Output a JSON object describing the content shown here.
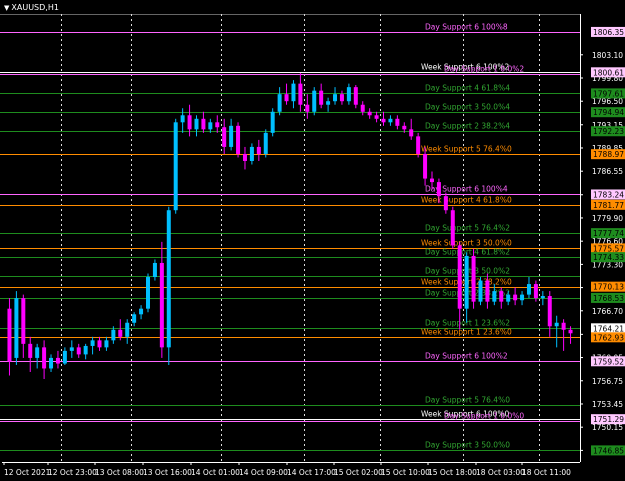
{
  "window": {
    "symbol": "XAUUSD,H1",
    "dropdown_glyph": "▼"
  },
  "colors": {
    "background": "#000000",
    "bull": "#00bfff",
    "bear": "#ff00ff",
    "grid": "#ffffff",
    "day_line": "#c080c0",
    "week_line": "#ff8c00",
    "green_line": "#1e8c1e",
    "green_text": "#32a832",
    "pink_line": "#ff66ff"
  },
  "chart_data": {
    "type": "candlestick",
    "ylim": [
      1745.2,
      1808.9
    ],
    "y_ticks": [
      "1803.10",
      "1799.80",
      "1796.50",
      "1793.15",
      "1789.85",
      "1786.55",
      "1783.20",
      "1779.90",
      "1776.60",
      "1773.30",
      "1770.00",
      "1766.70",
      "1763.35",
      "1760.05",
      "1756.75",
      "1753.45",
      "1750.15",
      "1746.85"
    ],
    "x_ticks": [
      "12 Oct 2021",
      "12 Oct 23:00",
      "13 Oct 08:00",
      "13 Oct 16:00",
      "14 Oct 01:00",
      "14 Oct 09:00",
      "14 Oct 17:00",
      "15 Oct 02:00",
      "15 Oct 10:00",
      "15 Oct 18:00",
      "18 Oct 03:00",
      "18 Oct 11:00"
    ],
    "candles": [
      {
        "o": 1767.0,
        "h": 1768.5,
        "l": 1757.5,
        "c": 1759.5
      },
      {
        "o": 1760.0,
        "h": 1769.5,
        "l": 1759.0,
        "c": 1768.5
      },
      {
        "o": 1768.5,
        "h": 1769.0,
        "l": 1760.0,
        "c": 1762.0
      },
      {
        "o": 1762.0,
        "h": 1763.0,
        "l": 1758.0,
        "c": 1760.0
      },
      {
        "o": 1760.0,
        "h": 1762.0,
        "l": 1758.5,
        "c": 1761.5
      },
      {
        "o": 1761.5,
        "h": 1762.5,
        "l": 1757.0,
        "c": 1758.5
      },
      {
        "o": 1758.5,
        "h": 1760.5,
        "l": 1758.0,
        "c": 1760.0
      },
      {
        "o": 1760.0,
        "h": 1761.0,
        "l": 1758.5,
        "c": 1759.2
      },
      {
        "o": 1759.2,
        "h": 1761.5,
        "l": 1759.0,
        "c": 1761.0
      },
      {
        "o": 1761.0,
        "h": 1762.5,
        "l": 1760.0,
        "c": 1761.5
      },
      {
        "o": 1761.5,
        "h": 1762.0,
        "l": 1760.0,
        "c": 1760.5
      },
      {
        "o": 1760.5,
        "h": 1762.0,
        "l": 1759.8,
        "c": 1761.7
      },
      {
        "o": 1761.7,
        "h": 1763.0,
        "l": 1760.5,
        "c": 1762.5
      },
      {
        "o": 1762.5,
        "h": 1763.0,
        "l": 1761.0,
        "c": 1761.5
      },
      {
        "o": 1761.5,
        "h": 1763.0,
        "l": 1761.0,
        "c": 1762.5
      },
      {
        "o": 1762.5,
        "h": 1764.5,
        "l": 1762.0,
        "c": 1764.0
      },
      {
        "o": 1764.0,
        "h": 1765.5,
        "l": 1762.5,
        "c": 1763.0
      },
      {
        "o": 1763.0,
        "h": 1765.5,
        "l": 1762.0,
        "c": 1765.0
      },
      {
        "o": 1765.0,
        "h": 1766.5,
        "l": 1764.5,
        "c": 1766.2
      },
      {
        "o": 1766.2,
        "h": 1767.5,
        "l": 1765.5,
        "c": 1767.0
      },
      {
        "o": 1767.0,
        "h": 1772.0,
        "l": 1766.5,
        "c": 1771.5
      },
      {
        "o": 1771.5,
        "h": 1774.0,
        "l": 1771.0,
        "c": 1773.5
      },
      {
        "o": 1773.5,
        "h": 1776.5,
        "l": 1760.0,
        "c": 1761.5
      },
      {
        "o": 1761.5,
        "h": 1781.5,
        "l": 1759.0,
        "c": 1781.0
      },
      {
        "o": 1781.0,
        "h": 1794.0,
        "l": 1780.5,
        "c": 1793.5
      },
      {
        "o": 1793.5,
        "h": 1795.5,
        "l": 1792.0,
        "c": 1794.5
      },
      {
        "o": 1794.5,
        "h": 1796.0,
        "l": 1791.5,
        "c": 1792.5
      },
      {
        "o": 1792.5,
        "h": 1794.5,
        "l": 1791.5,
        "c": 1794.0
      },
      {
        "o": 1794.0,
        "h": 1795.0,
        "l": 1792.0,
        "c": 1792.5
      },
      {
        "o": 1792.5,
        "h": 1794.0,
        "l": 1792.0,
        "c": 1793.5
      },
      {
        "o": 1793.5,
        "h": 1794.5,
        "l": 1792.0,
        "c": 1792.8
      },
      {
        "o": 1792.8,
        "h": 1794.0,
        "l": 1789.0,
        "c": 1790.0
      },
      {
        "o": 1790.0,
        "h": 1794.0,
        "l": 1789.5,
        "c": 1793.0
      },
      {
        "o": 1793.0,
        "h": 1793.5,
        "l": 1788.5,
        "c": 1789.0
      },
      {
        "o": 1789.0,
        "h": 1790.0,
        "l": 1786.8,
        "c": 1788.0
      },
      {
        "o": 1788.0,
        "h": 1790.5,
        "l": 1787.5,
        "c": 1790.0
      },
      {
        "o": 1790.0,
        "h": 1791.0,
        "l": 1788.0,
        "c": 1789.0
      },
      {
        "o": 1789.0,
        "h": 1792.5,
        "l": 1788.5,
        "c": 1792.0
      },
      {
        "o": 1792.0,
        "h": 1795.5,
        "l": 1791.5,
        "c": 1795.0
      },
      {
        "o": 1795.0,
        "h": 1798.5,
        "l": 1794.5,
        "c": 1797.5
      },
      {
        "o": 1797.5,
        "h": 1799.0,
        "l": 1796.0,
        "c": 1796.5
      },
      {
        "o": 1796.5,
        "h": 1799.5,
        "l": 1795.5,
        "c": 1799.0
      },
      {
        "o": 1799.0,
        "h": 1800.5,
        "l": 1795.0,
        "c": 1796.0
      },
      {
        "o": 1796.0,
        "h": 1797.5,
        "l": 1794.0,
        "c": 1795.0
      },
      {
        "o": 1795.0,
        "h": 1798.5,
        "l": 1794.5,
        "c": 1798.0
      },
      {
        "o": 1798.0,
        "h": 1799.0,
        "l": 1795.5,
        "c": 1796.0
      },
      {
        "o": 1796.0,
        "h": 1797.0,
        "l": 1795.0,
        "c": 1796.5
      },
      {
        "o": 1796.5,
        "h": 1798.5,
        "l": 1796.0,
        "c": 1797.5
      },
      {
        "o": 1797.5,
        "h": 1798.0,
        "l": 1796.0,
        "c": 1796.5
      },
      {
        "o": 1796.5,
        "h": 1799.0,
        "l": 1796.0,
        "c": 1798.5
      },
      {
        "o": 1798.5,
        "h": 1798.8,
        "l": 1795.5,
        "c": 1796.0
      },
      {
        "o": 1796.0,
        "h": 1796.5,
        "l": 1794.5,
        "c": 1795.0
      },
      {
        "o": 1795.0,
        "h": 1795.5,
        "l": 1794.0,
        "c": 1794.5
      },
      {
        "o": 1794.5,
        "h": 1795.0,
        "l": 1793.5,
        "c": 1794.0
      },
      {
        "o": 1794.0,
        "h": 1795.0,
        "l": 1793.0,
        "c": 1793.5
      },
      {
        "o": 1793.5,
        "h": 1794.5,
        "l": 1793.0,
        "c": 1794.0
      },
      {
        "o": 1794.0,
        "h": 1794.5,
        "l": 1792.5,
        "c": 1793.0
      },
      {
        "o": 1793.0,
        "h": 1793.5,
        "l": 1792.0,
        "c": 1792.5
      },
      {
        "o": 1792.5,
        "h": 1794.0,
        "l": 1791.0,
        "c": 1791.5
      },
      {
        "o": 1791.5,
        "h": 1792.0,
        "l": 1788.5,
        "c": 1789.0
      },
      {
        "o": 1789.0,
        "h": 1790.0,
        "l": 1784.5,
        "c": 1785.5
      },
      {
        "o": 1785.5,
        "h": 1786.5,
        "l": 1784.0,
        "c": 1785.0
      },
      {
        "o": 1785.0,
        "h": 1785.5,
        "l": 1782.0,
        "c": 1783.0
      },
      {
        "o": 1783.0,
        "h": 1783.5,
        "l": 1780.5,
        "c": 1781.0
      },
      {
        "o": 1781.0,
        "h": 1781.5,
        "l": 1775.5,
        "c": 1776.0
      },
      {
        "o": 1776.0,
        "h": 1776.5,
        "l": 1764.0,
        "c": 1767.0
      },
      {
        "o": 1767.0,
        "h": 1775.0,
        "l": 1765.0,
        "c": 1774.5
      },
      {
        "o": 1774.5,
        "h": 1775.5,
        "l": 1767.0,
        "c": 1768.0
      },
      {
        "o": 1768.0,
        "h": 1771.5,
        "l": 1767.5,
        "c": 1771.0
      },
      {
        "o": 1771.0,
        "h": 1772.0,
        "l": 1767.0,
        "c": 1768.0
      },
      {
        "o": 1768.0,
        "h": 1770.5,
        "l": 1767.5,
        "c": 1769.5
      },
      {
        "o": 1769.5,
        "h": 1770.0,
        "l": 1767.0,
        "c": 1768.0
      },
      {
        "o": 1768.0,
        "h": 1769.5,
        "l": 1767.5,
        "c": 1769.0
      },
      {
        "o": 1769.0,
        "h": 1770.0,
        "l": 1767.5,
        "c": 1768.2
      },
      {
        "o": 1768.2,
        "h": 1769.5,
        "l": 1767.5,
        "c": 1769.0
      },
      {
        "o": 1769.0,
        "h": 1771.5,
        "l": 1768.5,
        "c": 1770.5
      },
      {
        "o": 1770.5,
        "h": 1771.0,
        "l": 1768.0,
        "c": 1768.5
      },
      {
        "o": 1768.5,
        "h": 1769.5,
        "l": 1767.5,
        "c": 1768.8
      },
      {
        "o": 1768.8,
        "h": 1769.5,
        "l": 1763.0,
        "c": 1764.5
      },
      {
        "o": 1764.5,
        "h": 1766.0,
        "l": 1761.5,
        "c": 1765.0
      },
      {
        "o": 1765.0,
        "h": 1765.5,
        "l": 1761.0,
        "c": 1764.0
      },
      {
        "o": 1764.0,
        "h": 1764.5,
        "l": 1762.0,
        "c": 1763.5
      }
    ]
  },
  "price_axis": {
    "boxes": [
      {
        "text": "1806.35",
        "fill": "#ffc8ff",
        "v": 1806.35
      },
      {
        "text": "1800.61",
        "fill": "#ffc8ff",
        "v": 1800.61
      },
      {
        "text": "1797.61",
        "fill": "#1e8c1e",
        "v": 1797.61
      },
      {
        "text": "1794.94",
        "fill": "#1e8c1e",
        "v": 1794.94
      },
      {
        "text": "1792.23",
        "fill": "#1e8c1e",
        "v": 1792.23
      },
      {
        "text": "1788.97",
        "fill": "#ff8c00",
        "v": 1788.97
      },
      {
        "text": "1783.24",
        "fill": "#ffc8ff",
        "v": 1783.24
      },
      {
        "text": "1781.77",
        "fill": "#ff8c00",
        "v": 1781.77
      },
      {
        "text": "1777.74",
        "fill": "#1e8c1e",
        "v": 1777.74
      },
      {
        "text": "1775.57",
        "fill": "#ff8c00",
        "v": 1775.57
      },
      {
        "text": "1774.33",
        "fill": "#1e8c1e",
        "v": 1774.33
      },
      {
        "text": "1770.13",
        "fill": "#ff8c00",
        "v": 1770.13
      },
      {
        "text": "1768.53",
        "fill": "#1e8c1e",
        "v": 1768.53
      },
      {
        "text": "1764.21",
        "fill": "#ffffff",
        "v": 1764.21
      },
      {
        "text": "1762.93",
        "fill": "#ff8c00",
        "v": 1762.93
      },
      {
        "text": "1759.52",
        "fill": "#ffc8ff",
        "v": 1759.52
      },
      {
        "text": "1751.29",
        "fill": "#ffc8ff",
        "v": 1751.29
      },
      {
        "text": "1746.85",
        "fill": "#1e8c1e",
        "v": 1746.85
      }
    ]
  },
  "levels": [
    {
      "label": "Day Support 6 100%8",
      "v": 1806.35,
      "line": "#ff66ff",
      "text": "#ff66ff",
      "lx": 425
    },
    {
      "label": "Week Support 6 100%2",
      "v": 1800.61,
      "line": "#ffffff",
      "text": "#ffffff",
      "lx": 421
    },
    {
      "label": "Day Support 1 0.0%2",
      "v": 1800.4,
      "line": "#ff66ff",
      "text": "#ff66ff",
      "lx": 444
    },
    {
      "label": "Day Support 4 61.8%4",
      "v": 1797.61,
      "line": "#1e8c1e",
      "text": "#32a832",
      "lx": 425
    },
    {
      "label": "Day Support 3 50.0%4",
      "v": 1794.94,
      "line": "#1e8c1e",
      "text": "#32a832",
      "lx": 425
    },
    {
      "label": "Day Support 2 38.2%4",
      "v": 1792.23,
      "line": "#1e8c1e",
      "text": "#32a832",
      "lx": 425
    },
    {
      "label": "Week Support 5 76.4%0",
      "v": 1788.97,
      "line": "#ff8c00",
      "text": "#ff8c00",
      "lx": 421
    },
    {
      "label": "Day Support 6 100%4",
      "v": 1783.24,
      "line": "#ff66ff",
      "text": "#ff66ff",
      "lx": 425
    },
    {
      "label": "Week Support 4 61.8%0",
      "v": 1781.77,
      "line": "#ff8c00",
      "text": "#ff8c00",
      "lx": 421
    },
    {
      "label": "Day Support 5 76.4%2",
      "v": 1777.74,
      "line": "#1e8c1e",
      "text": "#32a832",
      "lx": 425
    },
    {
      "label": "Week Support 3 50.0%0",
      "v": 1775.57,
      "line": "#ff8c00",
      "text": "#ff8c00",
      "lx": 421
    },
    {
      "label": "Day Support 4 61.8%2",
      "v": 1774.33,
      "line": "#1e8c1e",
      "text": "#32a832",
      "lx": 425
    },
    {
      "label": "Day Support 3 50.0%2",
      "v": 1771.6,
      "line": "#1e8c1e",
      "text": "#32a832",
      "lx": 425
    },
    {
      "label": "Week Support 2 38.2%0",
      "v": 1770.13,
      "line": "#ff8c00",
      "text": "#ff8c00",
      "lx": 421
    },
    {
      "label": "Day Support 2 38.2%2",
      "v": 1768.53,
      "line": "#1e8c1e",
      "text": "#32a832",
      "lx": 425
    },
    {
      "label": "Day Support 1 23.6%2",
      "v": 1764.21,
      "line": "#1e8c1e",
      "text": "#32a832",
      "lx": 425
    },
    {
      "label": "Week Support 1 23.6%0",
      "v": 1762.93,
      "line": "#ff8c00",
      "text": "#ff8c00",
      "lx": 421
    },
    {
      "label": "Day Support 6 100%2",
      "v": 1759.52,
      "line": "#ff66ff",
      "text": "#ff66ff",
      "lx": 425
    },
    {
      "label": "Day Support 5 76.4%0",
      "v": 1753.3,
      "line": "#1e8c1e",
      "text": "#32a832",
      "lx": 425
    },
    {
      "label": "Week Support 6 100%0",
      "v": 1751.29,
      "line": "#ffffff",
      "text": "#ffffff",
      "lx": 421
    },
    {
      "label": "Day Support 1 0.0%0",
      "v": 1751.1,
      "line": "#ff66ff",
      "text": "#ff66ff",
      "lx": 444
    },
    {
      "label": "Day Support 3 50.0%0",
      "v": 1746.85,
      "line": "#1e8c1e",
      "text": "#32a832",
      "lx": 425
    }
  ]
}
